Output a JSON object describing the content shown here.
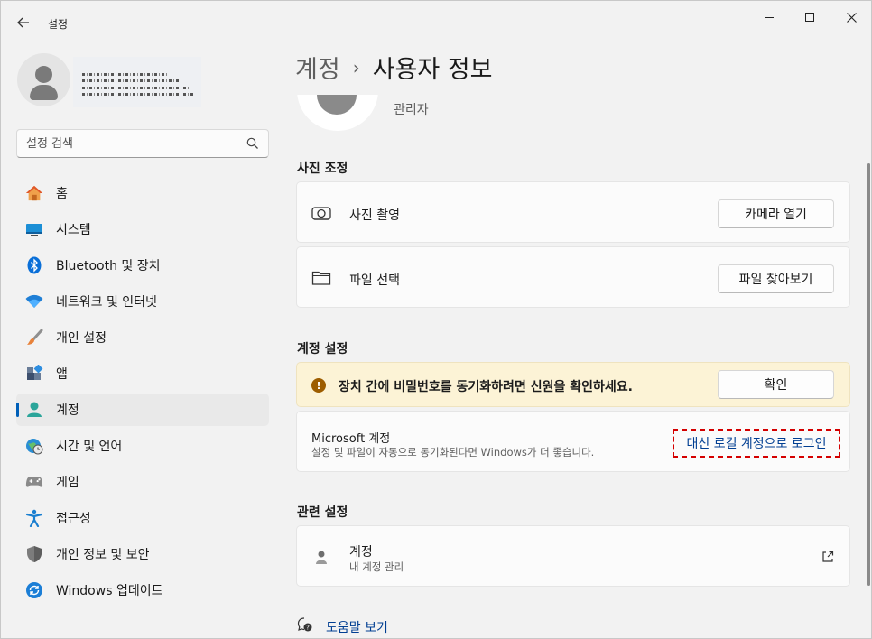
{
  "window": {
    "app_title": "설정",
    "controls": {
      "minimize": "minimize-icon",
      "maximize": "maximize-icon",
      "close": "close-icon"
    }
  },
  "profile": {
    "account_name": "",
    "account_email": ""
  },
  "search": {
    "placeholder": "설정 검색",
    "value": ""
  },
  "sidebar": {
    "items": [
      {
        "label": "홈",
        "icon": "home-icon",
        "active": false
      },
      {
        "label": "시스템",
        "icon": "monitor-icon",
        "active": false
      },
      {
        "label": "Bluetooth 및 장치",
        "icon": "bluetooth-icon",
        "active": false
      },
      {
        "label": "네트워크 및 인터넷",
        "icon": "wifi-icon",
        "active": false
      },
      {
        "label": "개인 설정",
        "icon": "brush-icon",
        "active": false
      },
      {
        "label": "앱",
        "icon": "apps-icon",
        "active": false
      },
      {
        "label": "계정",
        "icon": "account-icon",
        "active": true
      },
      {
        "label": "시간 및 언어",
        "icon": "globe-clock-icon",
        "active": false
      },
      {
        "label": "게임",
        "icon": "gamepad-icon",
        "active": false
      },
      {
        "label": "접근성",
        "icon": "accessibility-icon",
        "active": false
      },
      {
        "label": "개인 정보 및 보안",
        "icon": "shield-icon",
        "active": false
      },
      {
        "label": "Windows 업데이트",
        "icon": "update-icon",
        "active": false
      }
    ]
  },
  "breadcrumb": {
    "parent": "계정",
    "separator": "›",
    "current": "사용자 정보"
  },
  "user": {
    "role": "관리자"
  },
  "photo_section": {
    "title": "사진 조정",
    "take_photo": {
      "label": "사진 촬영",
      "button": "카메라 열기"
    },
    "choose_file": {
      "label": "파일 선택",
      "button": "파일 찾아보기"
    }
  },
  "account_settings": {
    "title": "계정 설정",
    "warning": {
      "text": "장치 간에 비밀번호를 동기화하려면 신원을 확인하세요.",
      "button": "확인"
    },
    "microsoft": {
      "title": "Microsoft 계정",
      "subtitle": "설정 및 파일이 자동으로 동기화된다면 Windows가 더 좋습니다.",
      "link": "대신 로컬 계정으로 로그인"
    }
  },
  "related": {
    "title": "관련 설정",
    "accounts": {
      "title": "계정",
      "subtitle": "내 계정 관리"
    }
  },
  "help": {
    "label": "도움말 보기"
  },
  "colors": {
    "accent": "#005fb8",
    "link": "#003e92",
    "warning_bg": "#fcf3d6",
    "highlight_dash": "#d40000"
  }
}
